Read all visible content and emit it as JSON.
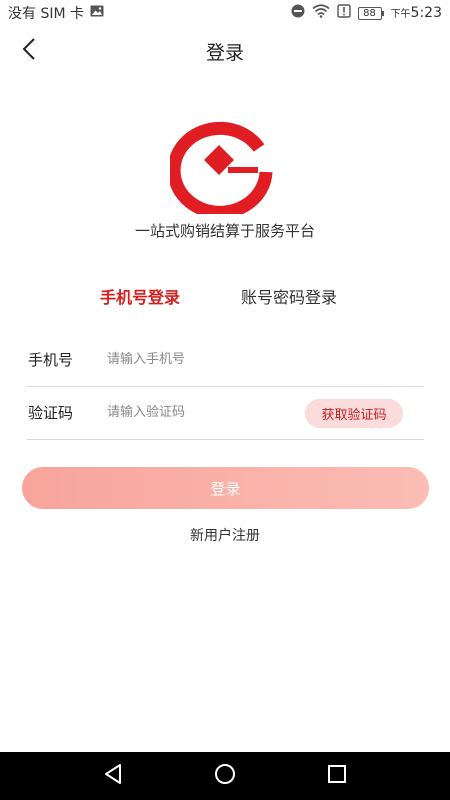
{
  "status_bar": {
    "carrier": "没有 SIM 卡",
    "battery": "88",
    "period": "下午",
    "time": "5:23"
  },
  "header": {
    "title": "登录"
  },
  "brand": {
    "slogan": "一站式购销结算于服务平台"
  },
  "tabs": [
    {
      "label": "手机号登录",
      "active": true
    },
    {
      "label": "账号密码登录",
      "active": false
    }
  ],
  "form": {
    "phone_label": "手机号",
    "phone_placeholder": "请输入手机号",
    "code_label": "验证码",
    "code_placeholder": "请输入验证码",
    "get_code_label": "获取验证码"
  },
  "login_button": "登录",
  "register_link": "新用户注册",
  "colors": {
    "accent": "#d41f1f",
    "login_button": "#fbb0a7",
    "get_code_bg": "#fadcdc"
  }
}
